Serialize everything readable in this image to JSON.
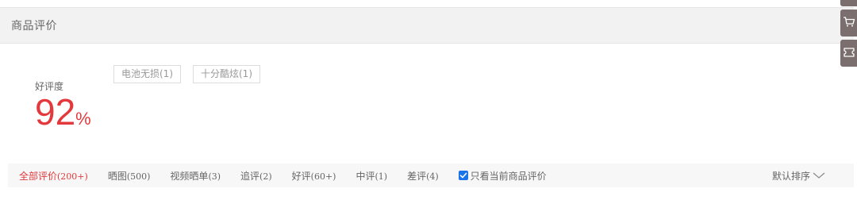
{
  "section": {
    "title": "商品评价"
  },
  "rating": {
    "label": "好评度",
    "value": "92",
    "unit": "%",
    "accent_color": "#e4393c"
  },
  "tags": [
    {
      "label": "电池无损(1)"
    },
    {
      "label": "十分酷炫(1)"
    }
  ],
  "filters": [
    {
      "label": "全部评价",
      "count": "(200+)",
      "active": true
    },
    {
      "label": "晒图",
      "count": "(500)",
      "active": false
    },
    {
      "label": "视频晒单",
      "count": "(3)",
      "active": false
    },
    {
      "label": "追评",
      "count": "(2)",
      "active": false
    },
    {
      "label": "好评",
      "count": "(60+)",
      "active": false
    },
    {
      "label": "中评",
      "count": "(1)",
      "active": false
    },
    {
      "label": "差评",
      "count": "(4)",
      "active": false
    }
  ],
  "only_current": {
    "label": "只看当前商品评价",
    "checked": true
  },
  "sort": {
    "label": "默认排序",
    "icon": "chevron-down-icon"
  },
  "side_toolbar": {
    "icons": [
      "cart-icon",
      "ticket-icon"
    ]
  }
}
